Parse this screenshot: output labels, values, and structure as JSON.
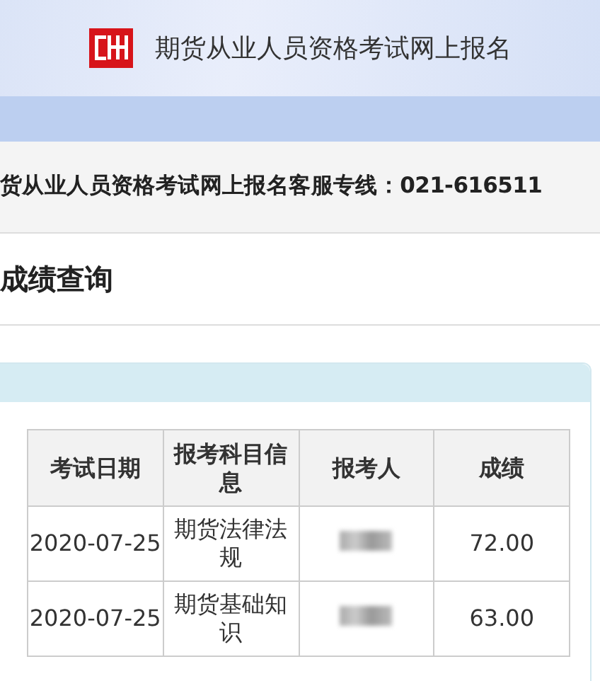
{
  "header": {
    "title": "期货从业人员资格考试网上报名"
  },
  "hotline": "货从业人员资格考试网上报名客服专线：021-616511",
  "section_title": "成绩查询",
  "table": {
    "columns": [
      "考试日期",
      "报考科目信息",
      "报考人",
      "成绩"
    ],
    "rows": [
      {
        "date": "2020-07-25",
        "subject": "期货法律法规",
        "candidate": {
          "kind": "redacted"
        },
        "score": "72.00"
      },
      {
        "date": "2020-07-25",
        "subject": "期货基础知识",
        "candidate": {
          "kind": "redacted"
        },
        "score": "63.00"
      }
    ]
  }
}
